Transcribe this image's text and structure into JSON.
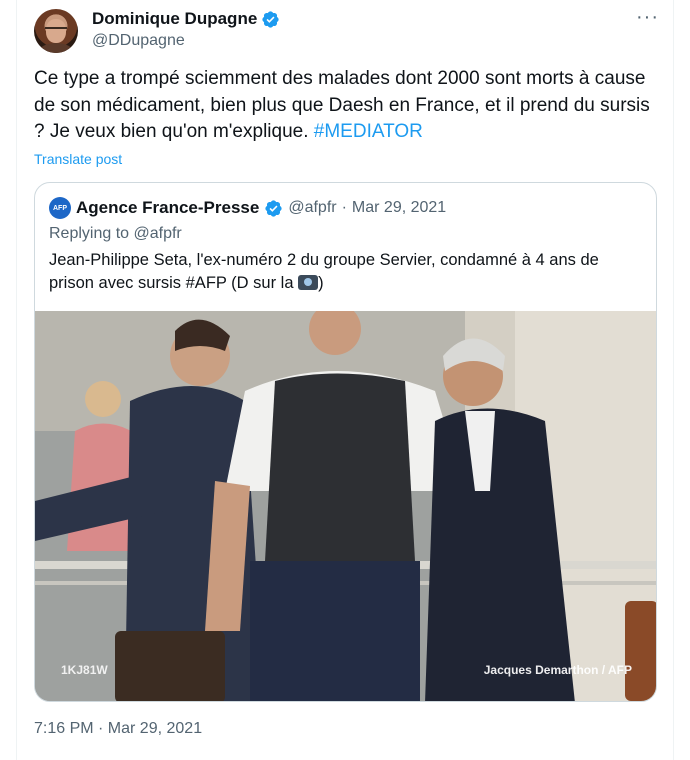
{
  "author": {
    "display_name": "Dominique Dupagne",
    "handle": "@DDupagne",
    "verified": true
  },
  "tweet": {
    "text": "Ce type a trompé sciemment des malades dont 2000 sont morts à cause de son médicament, bien plus que Daesh en France, et il prend du sursis ? Je veux bien qu'on m'explique. ",
    "hashtag": "#MEDIATOR",
    "translate_label": "Translate post",
    "timestamp": "7:16 PM · Mar 29, 2021"
  },
  "quoted": {
    "logo_text": "AFP",
    "display_name": "Agence France-Presse",
    "handle": "@afpfr",
    "separator": " · ",
    "date": "Mar 29, 2021",
    "replying_to": "Replying to @afpfr",
    "text": "Jean-Philippe Seta, l'ex-numéro 2 du groupe Servier, condamné à 4 ans de prison avec sursis #AFP (D sur la ",
    "text_end": ")",
    "photo": {
      "watermark": "1KJ81W",
      "credit": "Jacques Demarthon / AFP"
    }
  },
  "colors": {
    "accent": "#1d9bf0",
    "secondary_text": "#536471",
    "border": "#cfd9de"
  },
  "icons": [
    "verified-badge-icon",
    "more-options-icon",
    "camera-emoji-icon"
  ]
}
